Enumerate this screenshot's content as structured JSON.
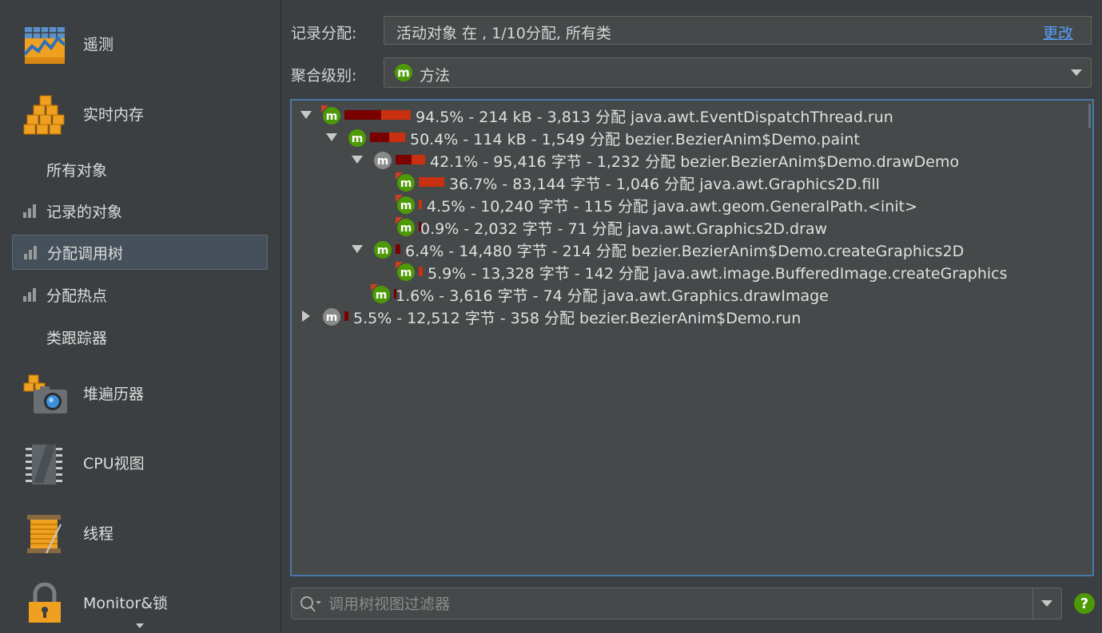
{
  "sidebar": {
    "telemetry": "遥测",
    "live_memory": "实时内存",
    "all_objects": "所有对象",
    "recorded_objects": "记录的对象",
    "allocation_tree": "分配调用树",
    "allocation_hotspots": "分配热点",
    "class_tracker": "类跟踪器",
    "heap_walker": "堆遍历器",
    "cpu_views": "CPU视图",
    "threads": "线程",
    "monitors": "Monitor&锁"
  },
  "form": {
    "record_label": "记录分配:",
    "record_value": "活动对象 在 , 1/10分配, 所有类",
    "change_link": "更改",
    "agg_label": "聚合级别:",
    "agg_value": "方法"
  },
  "tree": [
    {
      "text": "94.5% - 214 kB - 3,813 分配 java.awt.EventDispatchThread.run",
      "bar_fraction": 0.945
    },
    {
      "text": "50.4% - 114 kB - 1,549 分配 bezier.BezierAnim$Demo.paint",
      "bar_fraction": 0.504
    },
    {
      "text": "42.1% - 95,416 字节 - 1,232 分配 bezier.BezierAnim$Demo.drawDemo",
      "bar_fraction": 0.421
    },
    {
      "text": "36.7% - 83,144 字节 - 1,046 分配 java.awt.Graphics2D.fill",
      "bar_fraction": 0.367
    },
    {
      "text": "4.5% - 10,240 字节 - 115 分配 java.awt.geom.GeneralPath.<init>",
      "bar_fraction": 0.045
    },
    {
      "text": "0.9% - 2,032 字节 - 71 分配 java.awt.Graphics2D.draw",
      "bar_fraction": 0.009
    },
    {
      "text": "6.4% - 14,480 字节 - 214 分配 bezier.BezierAnim$Demo.createGraphics2D",
      "bar_fraction": 0.064
    },
    {
      "text": "5.9% - 13,328 字节 - 142 分配 java.awt.image.BufferedImage.createGraphics",
      "bar_fraction": 0.059
    },
    {
      "text": "1.6% - 3,616 字节 - 74 分配 java.awt.Graphics.drawImage",
      "bar_fraction": 0.016
    },
    {
      "text": "5.5% - 12,512 字节 - 358 分配 bezier.BezierAnim$Demo.run",
      "bar_fraction": 0.055
    }
  ],
  "filter": {
    "placeholder": "调用树视图过滤器"
  },
  "colors": {
    "bar_dark": "#7a0000",
    "bar_bright": "#c83010",
    "method_green": "#4e9a06",
    "method_gray": "#8a8a8a",
    "link": "#589df6",
    "selection_border": "#4a77a8"
  }
}
